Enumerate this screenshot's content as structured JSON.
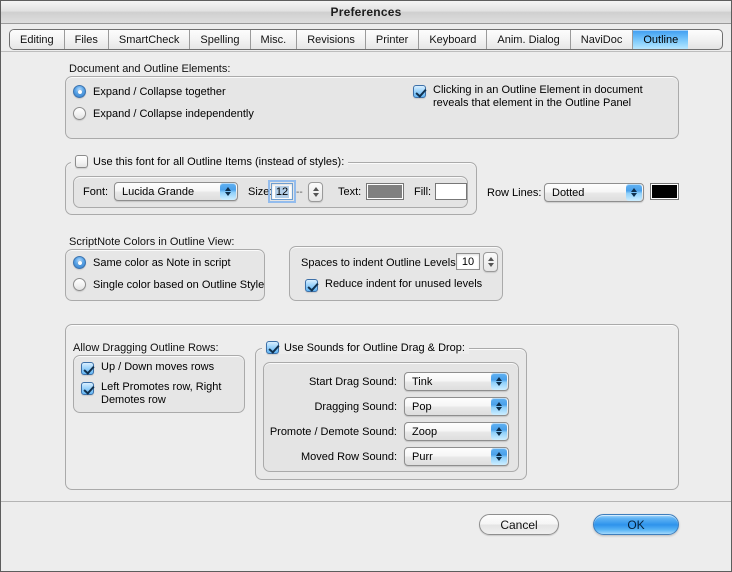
{
  "window": {
    "title": "Preferences"
  },
  "tabs": [
    {
      "label": "Editing",
      "selected": false
    },
    {
      "label": "Files",
      "selected": false
    },
    {
      "label": "SmartCheck",
      "selected": false
    },
    {
      "label": "Spelling",
      "selected": false
    },
    {
      "label": "Misc.",
      "selected": false
    },
    {
      "label": "Revisions",
      "selected": false
    },
    {
      "label": "Printer",
      "selected": false
    },
    {
      "label": "Keyboard",
      "selected": false
    },
    {
      "label": "Anim. Dialog",
      "selected": false
    },
    {
      "label": "NaviDoc",
      "selected": false
    },
    {
      "label": "Outline",
      "selected": true
    }
  ],
  "document_elements": {
    "caption": "Document and Outline Elements:",
    "expand_together": {
      "label": "Expand / Collapse together",
      "selected": true
    },
    "expand_independently": {
      "label": "Expand / Collapse independently",
      "selected": false
    },
    "reveal_checkbox": {
      "label": "Clicking in an Outline Element in document\nreveals that element in the Outline Panel",
      "checked": true
    }
  },
  "font_group": {
    "legend": "Use this font for all Outline Items (instead of styles):",
    "legend_checked": false,
    "font_label": "Font:",
    "font_value": "Lucida Grande",
    "size_label": "Size:",
    "size_value": "12",
    "size_separator": "--",
    "text_label": "Text:",
    "text_color": "#808080",
    "fill_label": "Fill:",
    "fill_color": "#ffffff"
  },
  "row_lines": {
    "label": "Row Lines:",
    "value": "Dotted",
    "color": "#000000"
  },
  "scriptnote_colors": {
    "caption": "ScriptNote Colors in Outline View:",
    "same_color": {
      "label": "Same color as Note in script",
      "selected": true
    },
    "single_color": {
      "label": "Single color based on Outline Style",
      "selected": false
    }
  },
  "indent_group": {
    "label": "Spaces to indent Outline Levels:",
    "value": "10",
    "reduce_indent": {
      "label": "Reduce indent for unused levels",
      "checked": true
    }
  },
  "dragging": {
    "caption": "Allow Dragging Outline Rows:",
    "up_down": {
      "label": "Up / Down moves rows",
      "checked": true
    },
    "left_right": {
      "label": "Left Promotes row, Right\nDemotes row",
      "checked": true
    }
  },
  "sounds": {
    "legend": "Use Sounds for Outline Drag & Drop:",
    "legend_checked": true,
    "rows": [
      {
        "label": "Start Drag Sound:",
        "value": "Tink"
      },
      {
        "label": "Dragging Sound:",
        "value": "Pop"
      },
      {
        "label": "Promote / Demote Sound:",
        "value": "Zoop"
      },
      {
        "label": "Moved Row Sound:",
        "value": "Purr"
      }
    ]
  },
  "buttons": {
    "cancel": "Cancel",
    "ok": "OK"
  }
}
